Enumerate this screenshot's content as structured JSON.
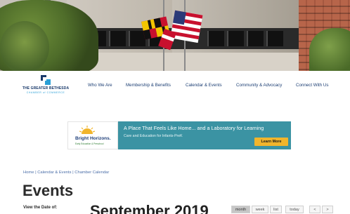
{
  "logo": {
    "line1": "THE GREATER BETHESDA",
    "line2": "CHAMBER of COMMERCE",
    "brand_color": "#1a3a6b",
    "accent_color": "#2a9fd6"
  },
  "nav": {
    "items": [
      {
        "label": "Who We Are"
      },
      {
        "label": "Membership & Benefits"
      },
      {
        "label": "Calendar & Events"
      },
      {
        "label": "Community & Advocacy"
      },
      {
        "label": "Connect With Us"
      }
    ]
  },
  "ad": {
    "brand": "Bright Horizons.",
    "tagline": "Early Education & Preschool",
    "title": "A Place That Feels Like Home... and a Laboratory for Learning",
    "subtitle": "Care and Education for Infants-PreK",
    "cta": "Learn More",
    "bg_color": "#3b93a3",
    "cta_color": "#f1b52c"
  },
  "breadcrumb": {
    "home": "Home",
    "sep": " | ",
    "section": "Calendar & Events",
    "current": "Chamber Calendar"
  },
  "page": {
    "title": "Events",
    "view_date_label": "View the Date of:",
    "month_title": "September 2019"
  },
  "calendar_controls": {
    "views": [
      "month",
      "week",
      "list"
    ],
    "active_view": "month",
    "today": "today",
    "prev": "<",
    "next": ">"
  }
}
